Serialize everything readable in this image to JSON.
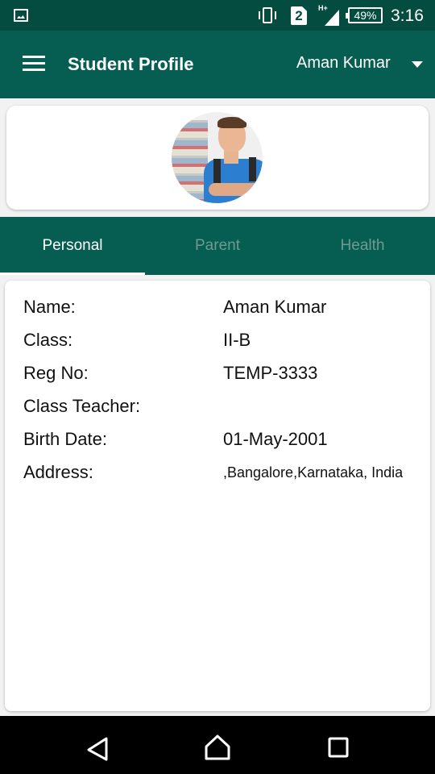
{
  "status_bar": {
    "sim_slot": "2",
    "network_type": "H+",
    "battery": "49%",
    "time": "3:16",
    "icons": [
      "image-notification-icon",
      "vibrate-icon",
      "sim-icon",
      "signal-icon",
      "battery-icon"
    ]
  },
  "app_bar": {
    "title": "Student Profile",
    "selected_student": "Aman Kumar",
    "menu_icon": "hamburger-icon",
    "dropdown_icon": "caret-down-icon"
  },
  "profile": {
    "avatar": "student-photo"
  },
  "tabs": [
    {
      "label": "Personal",
      "active": true
    },
    {
      "label": "Parent",
      "active": false
    },
    {
      "label": "Health",
      "active": false
    }
  ],
  "personal": {
    "fields": [
      {
        "label": "Name:",
        "value": "Aman Kumar"
      },
      {
        "label": "Class:",
        "value": "II-B"
      },
      {
        "label": "Reg No:",
        "value": "TEMP-3333"
      },
      {
        "label": "Class Teacher:",
        "value": ""
      },
      {
        "label": "Birth Date:",
        "value": "01-May-2001"
      },
      {
        "label": "Address:",
        "value": ",Bangalore,Karnataka, India"
      }
    ]
  },
  "nav_bar": {
    "buttons": [
      "back",
      "home",
      "recents"
    ]
  },
  "colors": {
    "status_bar": "#044c40",
    "primary": "#065e52",
    "tab_inactive_text": "#6f9a92",
    "card": "#ffffff"
  }
}
